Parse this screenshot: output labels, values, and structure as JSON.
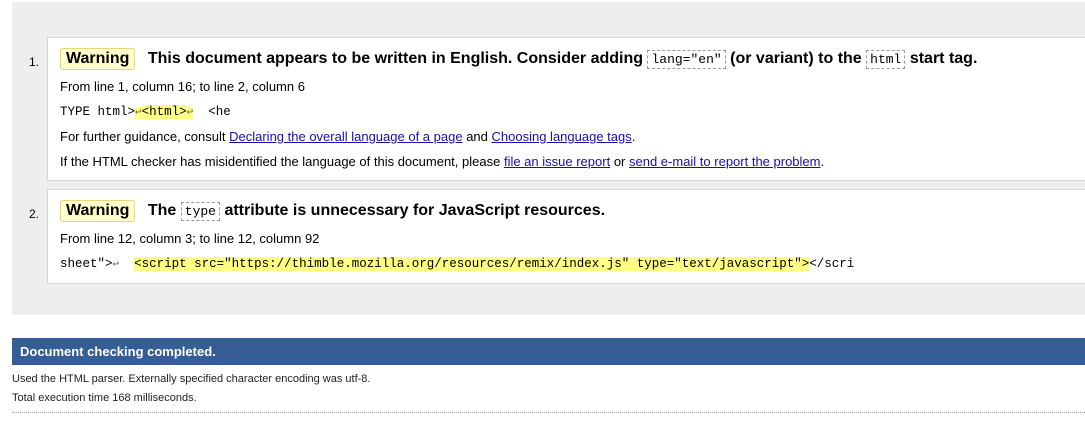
{
  "messages": [
    {
      "number": "1.",
      "badge": "Warning",
      "text_before": "This document appears to be written in English. Consider adding",
      "code1": "lang=\"en\"",
      "text_middle": "(or variant) to the",
      "code2": "html",
      "text_after": "start tag.",
      "location": "From line 1, column 16; to line 2, column 6",
      "extract_pre": "TYPE html>",
      "extract_ret1": "↩",
      "extract_hl": "<html>",
      "extract_ret2": "↩",
      "extract_post": "  <he",
      "guidance_prefix": "For further guidance, consult",
      "link1": "Declaring the overall language of a page",
      "guidance_and": "and",
      "link2": "Choosing language tags",
      "guidance_end": ".",
      "misid_prefix": "If the HTML checker has misidentified the language of this document, please",
      "link3": "file an issue report",
      "misid_or": "or",
      "link4": "send e-mail to report the problem",
      "misid_end": "."
    },
    {
      "number": "2.",
      "badge": "Warning",
      "text_before": "The",
      "code1": "type",
      "text_after": "attribute is unnecessary for JavaScript resources.",
      "location": "From line 12, column 3; to line 12, column 92",
      "extract_pre": "sheet\">",
      "extract_ret": "↩",
      "extract_hl": "<script src=\"https://thimble.mozilla.org/resources/remix/index.js\" type=\"text/javascript\">",
      "extract_post": "</scri"
    }
  ],
  "status": {
    "title": "Document checking completed.",
    "parser_info": "Used the HTML parser. Externally specified character encoding was utf-8.",
    "timing": "Total execution time 168 milliseconds."
  }
}
